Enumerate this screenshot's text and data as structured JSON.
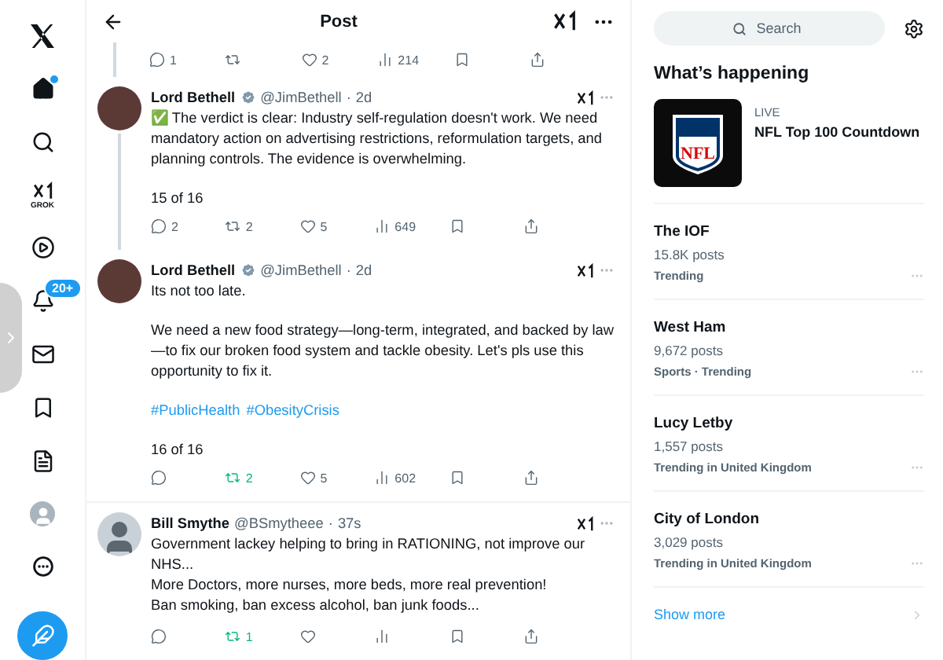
{
  "nav": {
    "items": [
      {
        "kind": "logo"
      },
      {
        "kind": "home",
        "dot": true
      },
      {
        "kind": "search"
      },
      {
        "kind": "grok",
        "label": "GROK"
      },
      {
        "kind": "video"
      },
      {
        "kind": "notifications",
        "badge": "20+"
      },
      {
        "kind": "messages"
      },
      {
        "kind": "bookmarks"
      },
      {
        "kind": "lists"
      },
      {
        "kind": "profile"
      },
      {
        "kind": "more"
      }
    ],
    "compose": true
  },
  "header": {
    "title": "Post"
  },
  "previous_actions": [
    {
      "kind": "reply",
      "count": "1",
      "active": false
    },
    {
      "kind": "repost",
      "active": false
    },
    {
      "kind": "like",
      "count": "2",
      "active": false
    },
    {
      "kind": "views",
      "count": "214",
      "active": false
    },
    {
      "kind": "bookmark",
      "active": false
    },
    {
      "kind": "share",
      "active": false
    }
  ],
  "tweets": [
    {
      "name": "Lord Bethell",
      "verified": true,
      "handle": "@JimBethell",
      "separator": "·",
      "time": "2d",
      "thread": true,
      "paragraphs": [
        "✅ The verdict is clear: Industry self-regulation doesn't work. We need mandatory action on advertising restrictions, reformulation targets, and planning controls. The evidence is overwhelming."
      ],
      "counter": "15 of 16",
      "actions": [
        {
          "kind": "reply",
          "count": "2",
          "active": false
        },
        {
          "kind": "repost",
          "count": "2",
          "active": false
        },
        {
          "kind": "like",
          "count": "5",
          "active": false
        },
        {
          "kind": "views",
          "count": "649",
          "active": false
        },
        {
          "kind": "bookmark",
          "active": false
        },
        {
          "kind": "share",
          "active": false
        }
      ]
    },
    {
      "name": "Lord Bethell",
      "verified": true,
      "handle": "@JimBethell",
      "separator": "·",
      "time": "2d",
      "thread": false,
      "paragraphs": [
        "Its not too late.",
        "We need a new food strategy—long-term, integrated, and backed by law—to fix our broken food system and tackle obesity. Let's pls use this opportunity to fix it."
      ],
      "hashtags": [
        "#PublicHealth",
        "#ObesityCrisis"
      ],
      "counter": "16 of 16",
      "actions": [
        {
          "kind": "reply",
          "active": false
        },
        {
          "kind": "repost",
          "count": "2",
          "active": true
        },
        {
          "kind": "like",
          "count": "5",
          "active": false
        },
        {
          "kind": "views",
          "count": "602",
          "active": false
        },
        {
          "kind": "bookmark",
          "active": false
        },
        {
          "kind": "share",
          "active": false
        }
      ]
    },
    {
      "name": "Bill Smythe",
      "verified": false,
      "handle": "@BSmytheee",
      "separator": "·",
      "time": "37s",
      "thread": false,
      "paragraphs": [
        "Government lackey helping to bring in RATIONING, not improve our NHS...\nMore Doctors, more nurses, more beds, more real prevention!\nBan smoking, ban excess alcohol, ban junk foods..."
      ],
      "actions": [
        {
          "kind": "reply",
          "active": false
        },
        {
          "kind": "repost",
          "count": "1",
          "active": true
        },
        {
          "kind": "like",
          "active": false
        },
        {
          "kind": "views",
          "active": false
        },
        {
          "kind": "bookmark",
          "active": false
        },
        {
          "kind": "share",
          "active": false
        }
      ]
    }
  ],
  "sidebar": {
    "search": {
      "placeholder": "Search"
    },
    "heading": "What’s happening",
    "live": {
      "label": "LIVE",
      "title": "NFL Top 100 Countdown",
      "logo_text": "NFL"
    },
    "trends": [
      {
        "title": "The IOF",
        "posts": "15.8K posts",
        "context": "Trending"
      },
      {
        "title": "West Ham",
        "posts": "9,672 posts",
        "context": "Sports · Trending"
      },
      {
        "title": "Lucy Letby",
        "posts": "1,557 posts",
        "context": "Trending in United Kingdom"
      },
      {
        "title": "City of London",
        "posts": "3,029 posts",
        "context": "Trending in United Kingdom"
      }
    ],
    "show_more": "Show more"
  }
}
